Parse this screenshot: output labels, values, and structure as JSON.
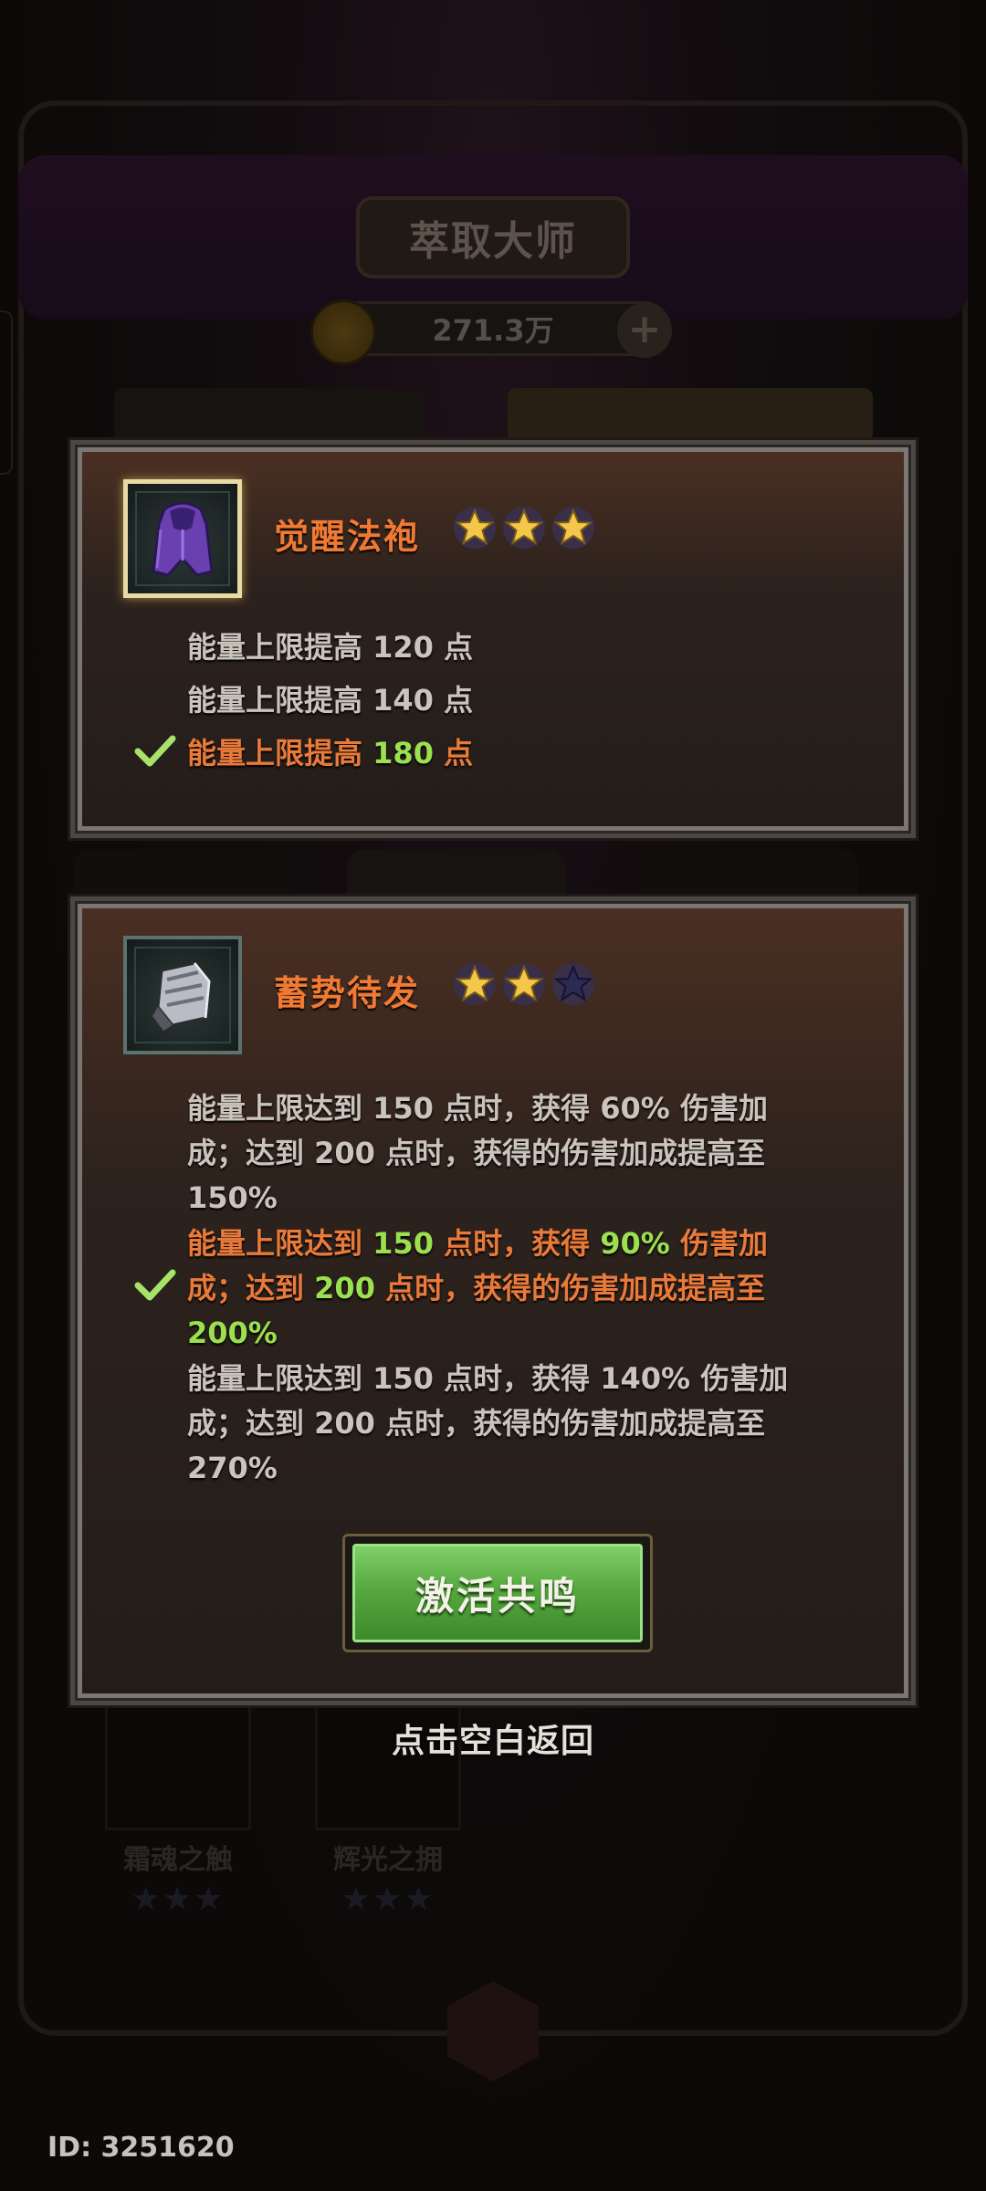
{
  "background": {
    "title": "萃取大师",
    "currency_value": "271.3万",
    "slots": [
      {
        "name": "霜魂之触",
        "stars": "★★★"
      },
      {
        "name": "辉光之拥",
        "stars": "★★★"
      }
    ]
  },
  "popup_top": {
    "item_name": "觉醒法袍",
    "stars_filled": 3,
    "stars_total": 3,
    "tiers": [
      {
        "text": "能量上限提高 120 点",
        "active": false
      },
      {
        "text": "能量上限提高 140 点",
        "active": false
      },
      {
        "prefix": "能量上限提高 ",
        "value": "180",
        "suffix": " 点",
        "active": true
      }
    ]
  },
  "popup_bottom": {
    "item_name": "蓄势待发",
    "stars_filled": 2,
    "stars_total": 3,
    "tiers": [
      {
        "line1": "能量上限达到 150 点时，获得 60% 伤害加",
        "line2": "成；达到 200 点时，获得的伤害加成提高至",
        "line3": "150%",
        "active": false
      },
      {
        "a": "能量上限达到 ",
        "b": "150",
        "c": " 点时，获得 ",
        "d": "90%",
        "e": " 伤害加",
        "f": "成；达到 ",
        "g": "200",
        "h": " 点时，获得的伤害加成提高至",
        "i": "200%",
        "active": true
      },
      {
        "line1": "能量上限达到 150 点时，获得 140% 伤害加",
        "line2": "成；达到 200 点时，获得的伤害加成提高至",
        "line3": "270%",
        "active": false
      }
    ],
    "activate_label": "激活共鸣"
  },
  "back_hint": "点击空白返回",
  "player_id": "ID: 3251620",
  "colors": {
    "item_name": "#f07a34",
    "highlight_value": "#9be04e",
    "button_green": "#57a840",
    "star_gold": "#f3c64c",
    "star_empty": "#2c2a55"
  }
}
